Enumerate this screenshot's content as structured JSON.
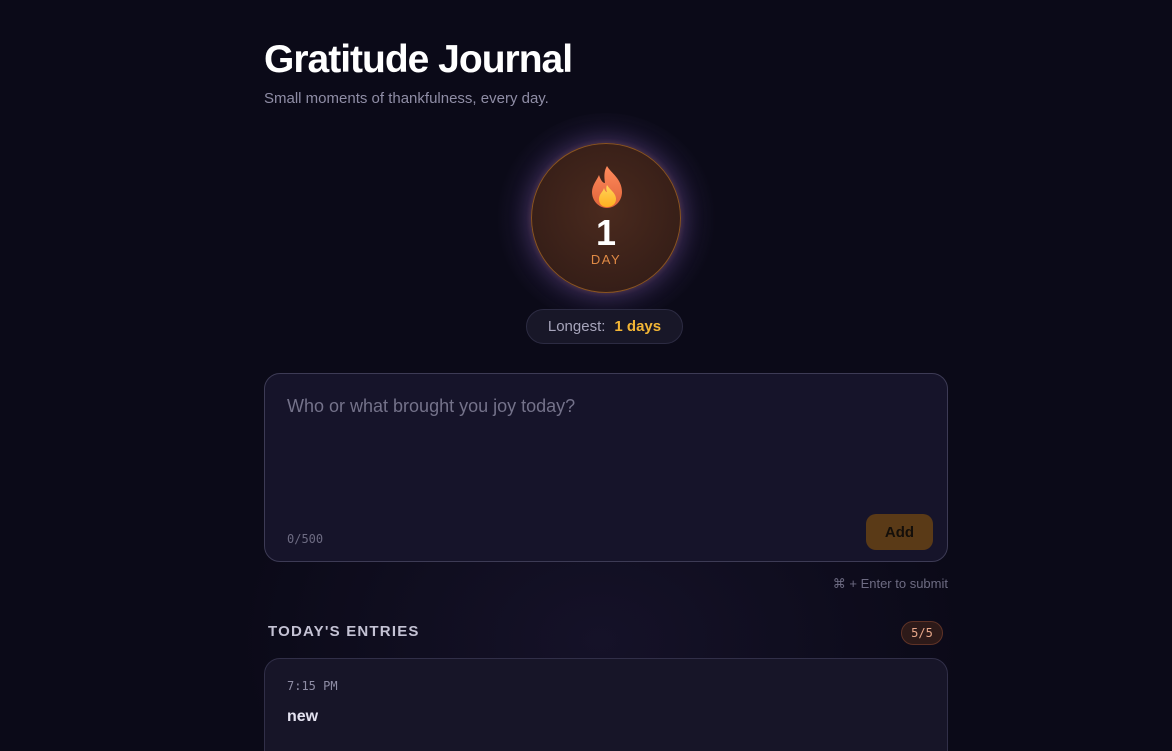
{
  "header": {
    "title": "Gratitude Journal",
    "subtitle": "Small moments of thankfulness, every day."
  },
  "streak": {
    "icon": "flame-icon",
    "count": "1",
    "unit": "DAY",
    "longest_label": "Longest:",
    "longest_value": "1 days"
  },
  "composer": {
    "placeholder": "Who or what brought you joy today?",
    "value": "",
    "char_counter": "0/500",
    "add_label": "Add",
    "hint": "⌘ + Enter to submit"
  },
  "entries": {
    "heading": "TODAY'S ENTRIES",
    "count_badge": "5/5",
    "items": [
      {
        "time": "7:15 PM",
        "text": "new"
      }
    ]
  },
  "colors": {
    "background": "#0b0a18",
    "accent_orange": "#e08a45",
    "accent_gold": "#f2b535",
    "add_button": "#5a3a17"
  }
}
